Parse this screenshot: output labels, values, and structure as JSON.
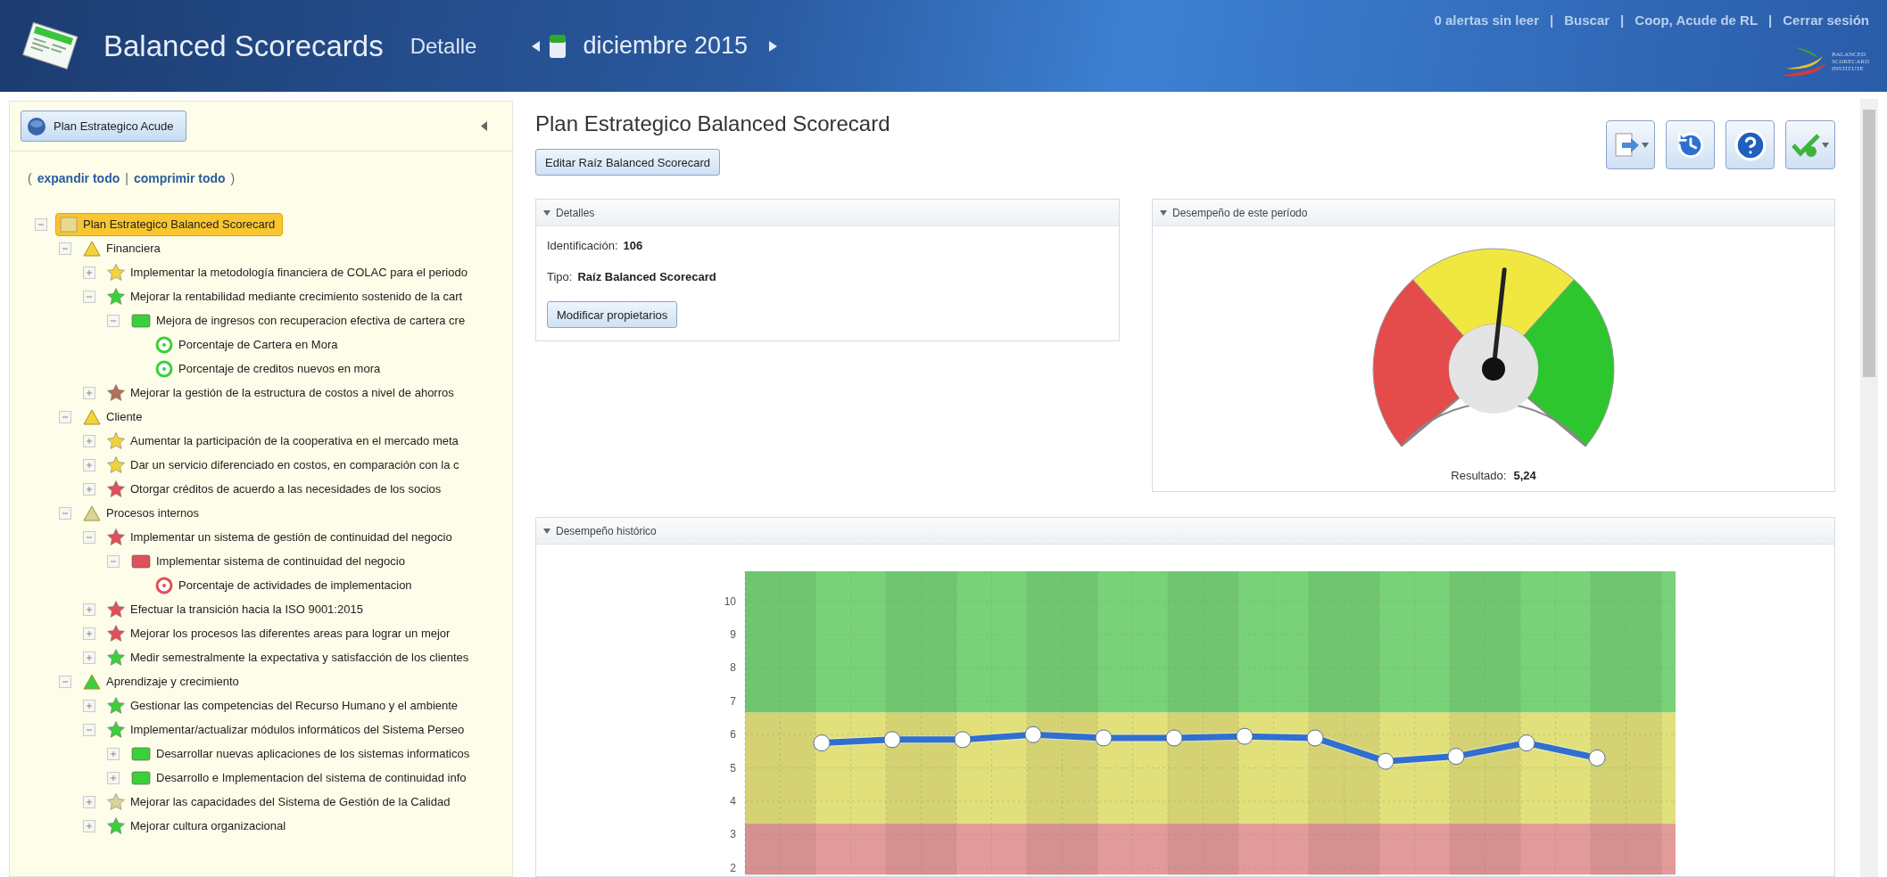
{
  "header": {
    "title": "Balanced Scorecards",
    "subtitle": "Detalle",
    "period": "diciembre 2015",
    "links": [
      {
        "label": "0 alertas sin leer"
      },
      {
        "label": "Buscar"
      },
      {
        "label": "Coop, Acude de RL"
      },
      {
        "label": "Cerrar sesión"
      }
    ],
    "separators": [
      "|",
      "|",
      "|"
    ],
    "brand_lines": [
      "BALANCED",
      "SCORECARD",
      "INSTITUTE"
    ]
  },
  "sidebar": {
    "plan_button": "Plan Estrategico Acude",
    "tree_controls": {
      "open": "(",
      "expand": "expandir todo",
      "separator": "|",
      "collapse": "comprimir todo",
      "close": ")"
    },
    "tree": [
      {
        "kind": "scorecard",
        "label": "Plan Estrategico Balanced Scorecard",
        "selected": true,
        "expanded": true,
        "color": "#e8d890",
        "children": [
          {
            "kind": "perspective",
            "label": "Financiera",
            "selected": false,
            "expanded": true,
            "color": "#f2d33a",
            "children": [
              {
                "kind": "objective",
                "label": "Implementar la metodología financiera de COLAC para el periodo",
                "selected": false,
                "expanded": false,
                "color": "#f2d33a"
              },
              {
                "kind": "objective",
                "label": "Mejorar la rentabilidad mediante crecimiento sostenido de la cart",
                "selected": false,
                "expanded": true,
                "color": "#3ccf3c",
                "children": [
                  {
                    "kind": "initiative",
                    "label": "Mejora de ingresos con recuperacion efectiva de cartera cre",
                    "selected": false,
                    "expanded": true,
                    "color": "#3ccf3c",
                    "children": [
                      {
                        "kind": "measure",
                        "label": "Porcentaje de Cartera en Mora",
                        "selected": false,
                        "color": "#3ccf3c"
                      },
                      {
                        "kind": "measure",
                        "label": "Porcentaje de creditos nuevos en mora",
                        "selected": false,
                        "color": "#3ccf3c"
                      }
                    ]
                  }
                ]
              },
              {
                "kind": "objective",
                "label": "Mejorar la gestión de la estructura de costos a nivel de ahorros",
                "selected": false,
                "expanded": false,
                "color": "#b0705a"
              }
            ]
          },
          {
            "kind": "perspective",
            "label": "Cliente",
            "selected": false,
            "expanded": true,
            "color": "#f2d33a",
            "children": [
              {
                "kind": "objective",
                "label": "Aumentar la participación de la cooperativa en el mercado meta",
                "selected": false,
                "expanded": false,
                "color": "#f2d33a"
              },
              {
                "kind": "objective",
                "label": "Dar un servicio diferenciado en costos, en comparación con la c",
                "selected": false,
                "expanded": false,
                "color": "#f2d33a"
              },
              {
                "kind": "objective",
                "label": "Otorgar créditos de acuerdo a las necesidades de los socios",
                "selected": false,
                "expanded": false,
                "color": "#e0505a"
              }
            ]
          },
          {
            "kind": "perspective",
            "label": "Procesos internos",
            "selected": false,
            "expanded": true,
            "color": "#d8d49a",
            "children": [
              {
                "kind": "objective",
                "label": "Implementar un sistema de gestión de continuidad del negocio",
                "selected": false,
                "expanded": true,
                "color": "#e0505a",
                "children": [
                  {
                    "kind": "initiative",
                    "label": "Implementar sistema de continuidad del negocio",
                    "selected": false,
                    "expanded": true,
                    "color": "#e0505a",
                    "children": [
                      {
                        "kind": "measure",
                        "label": "Porcentaje de actividades de implementacion",
                        "selected": false,
                        "color": "#e0505a"
                      }
                    ]
                  }
                ]
              },
              {
                "kind": "objective",
                "label": "Efectuar la transición hacia la ISO 9001:2015",
                "selected": false,
                "expanded": false,
                "color": "#e0505a"
              },
              {
                "kind": "objective",
                "label": "Mejorar los procesos las diferentes areas para lograr un mejor",
                "selected": false,
                "expanded": false,
                "color": "#e0505a"
              },
              {
                "kind": "objective",
                "label": "Medir semestralmente la expectativa y satisfacción de los clientes",
                "selected": false,
                "expanded": false,
                "color": "#3ccf3c"
              }
            ]
          },
          {
            "kind": "perspective",
            "label": "Aprendizaje y crecimiento",
            "selected": false,
            "expanded": true,
            "color": "#3ccf3c",
            "children": [
              {
                "kind": "objective",
                "label": "Gestionar las competencias del Recurso Humano y el ambiente",
                "selected": false,
                "expanded": false,
                "color": "#3ccf3c"
              },
              {
                "kind": "objective",
                "label": "Implementar/actualizar módulos informáticos del Sistema Perseo",
                "selected": false,
                "expanded": true,
                "color": "#3ccf3c",
                "children": [
                  {
                    "kind": "initiative",
                    "label": "Desarrollar nuevas aplicaciones de los sistemas informaticos",
                    "selected": false,
                    "expanded": false,
                    "color": "#3ccf3c"
                  },
                  {
                    "kind": "initiative",
                    "label": "Desarrollo e Implementacion del sistema de continuidad info",
                    "selected": false,
                    "expanded": false,
                    "color": "#3ccf3c"
                  }
                ]
              },
              {
                "kind": "objective",
                "label": "Mejorar las capacidades del Sistema de Gestión de la Calidad",
                "selected": false,
                "expanded": false,
                "color": "#d8d49a"
              },
              {
                "kind": "objective",
                "label": "Mejorar cultura organizacional",
                "selected": false,
                "expanded": false,
                "color": "#3ccf3c"
              }
            ]
          }
        ]
      }
    ]
  },
  "main": {
    "title": "Plan Estrategico Balanced Scorecard",
    "edit_button": "Editar Raíz Balanced Scorecard",
    "details": {
      "title": "Detalles",
      "fields": [
        {
          "label": "Identificación:",
          "value": "106"
        },
        {
          "label": "Tipo:",
          "value": "Raíz Balanced Scorecard"
        }
      ],
      "button": "Modificar propietarios"
    },
    "gauge": {
      "title": "Desempeño de este período",
      "result_label": "Resultado:",
      "result_value": "5,24"
    },
    "history": {
      "title": "Desempeño histórico",
      "chart_data": {
        "type": "line",
        "categories": [
          null,
          null,
          null,
          null,
          null,
          null,
          null,
          null,
          null,
          null,
          null,
          null
        ],
        "ylim": [
          1.8,
          10.9
        ],
        "yticks": [
          2,
          3,
          4,
          5,
          6,
          7,
          8,
          9,
          10
        ],
        "grid": true,
        "series": [
          {
            "color": "#2f6fd0",
            "marker": "circle",
            "values": [
              5.75,
              5.85,
              5.85,
              6.0,
              5.9,
              5.9,
              5.95,
              5.9,
              5.2,
              5.35,
              5.75,
              5.3
            ]
          }
        ],
        "bands": [
          {
            "axis": "y",
            "from": 1.8,
            "to": 3.33,
            "color": "#e39a9a"
          },
          {
            "axis": "y",
            "from": 3.33,
            "to": 6.67,
            "color": "#e2e07a"
          },
          {
            "axis": "y",
            "from": 6.67,
            "to": 10.9,
            "color": "#78d278"
          }
        ]
      }
    }
  }
}
